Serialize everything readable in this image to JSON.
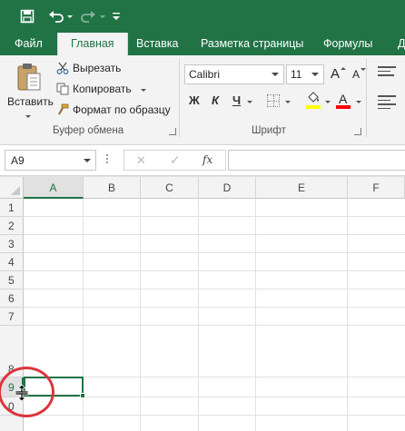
{
  "qat": {
    "icons": [
      "save-icon",
      "undo-icon",
      "redo-icon",
      "customize-qat-icon"
    ]
  },
  "tabs": [
    "Файл",
    "Главная",
    "Вставка",
    "Разметка страницы",
    "Формулы",
    "Д"
  ],
  "active_tab": "Главная",
  "ribbon": {
    "paste_label": "Вставить",
    "cut_label": "Вырезать",
    "copy_label": "Копировать",
    "format_painter_label": "Формат по образцу",
    "clipboard_group": "Буфер обмена",
    "font_name": "Calibri",
    "font_size": "11",
    "grow_font": "A",
    "shrink_font": "A",
    "bold": "Ж",
    "italic": "К",
    "underline": "Ч",
    "font_color_letter": "A",
    "font_group": "Шрифт",
    "colors": {
      "accent": "#217346",
      "highlight": "#ffff00",
      "font_color": "#ff0000"
    }
  },
  "formula_bar": {
    "name_box": "A9",
    "cancel_icon": "✕",
    "enter_icon": "✓",
    "fx_label": "fx",
    "value": ""
  },
  "sheet": {
    "columns": [
      "A",
      "B",
      "C",
      "D",
      "E",
      "F"
    ],
    "rows": [
      "1",
      "2",
      "3",
      "4",
      "5",
      "6",
      "7",
      "8",
      "9",
      "0"
    ],
    "selected_column": "A",
    "selected_row": "9"
  }
}
